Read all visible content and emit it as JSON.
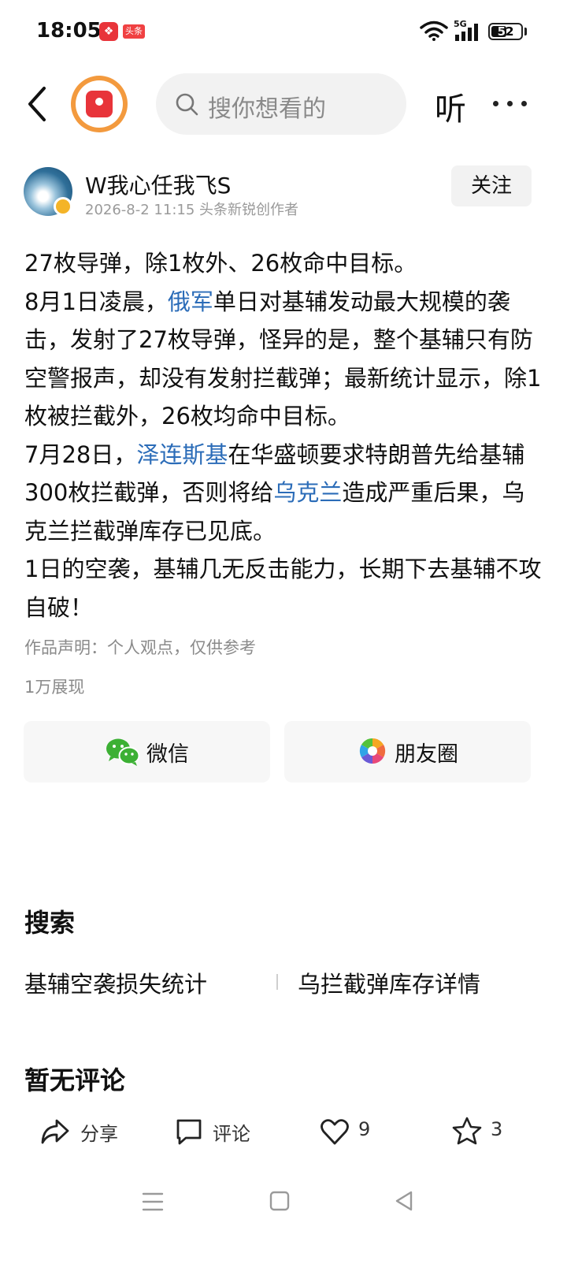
{
  "status_bar": {
    "time": "18:05",
    "app_badge": "头条",
    "network": "5G",
    "battery": "52",
    "battery_level": 0.52
  },
  "header": {
    "search_placeholder": "搜你想看的",
    "listen_label": "听"
  },
  "author": {
    "name": "W我心任我飞S",
    "meta": "2026-8-2 11:15  头条新锐创作者",
    "follow_label": "关注"
  },
  "article": {
    "p1": "27枚导弹，除1枚外、26枚命中目标。",
    "p2_pre": "8月1日凌晨，",
    "p2_link": "俄军",
    "p2_post": "单日对基辅发动最大规模的袭击，发射了27枚导弹，怪异的是，整个基辅只有防空警报声，却没有发射拦截弹；最新统计显示，除1枚被拦截外，26枚均命中目标。",
    "p3_pre": "7月28日，",
    "p3_link1": "泽连斯基",
    "p3_mid": "在华盛顿要求特朗普先给基辅300枚拦截弹，否则将给",
    "p3_link2": "乌克兰",
    "p3_post": "造成严重后果，乌克兰拦截弹库存已见底。",
    "p4": "1日的空袭，基辅几无反击能力，长期下去基辅不攻自破！",
    "statement": "作品声明：个人观点，仅供参考",
    "views": "1万展现"
  },
  "share": {
    "wechat": "微信",
    "moments": "朋友圈"
  },
  "search_section": {
    "title": "搜索",
    "suggestions": [
      "基辅空袭损失统计",
      "乌拦截弹库存详情"
    ]
  },
  "comments": {
    "title": "暂无评论"
  },
  "actions": {
    "share": "分享",
    "comment": "评论",
    "likes": "9",
    "favorites": "3"
  },
  "colors": {
    "link": "#2b6cb8",
    "brand_red": "#e8343a",
    "wechat_green": "#3cb034"
  }
}
